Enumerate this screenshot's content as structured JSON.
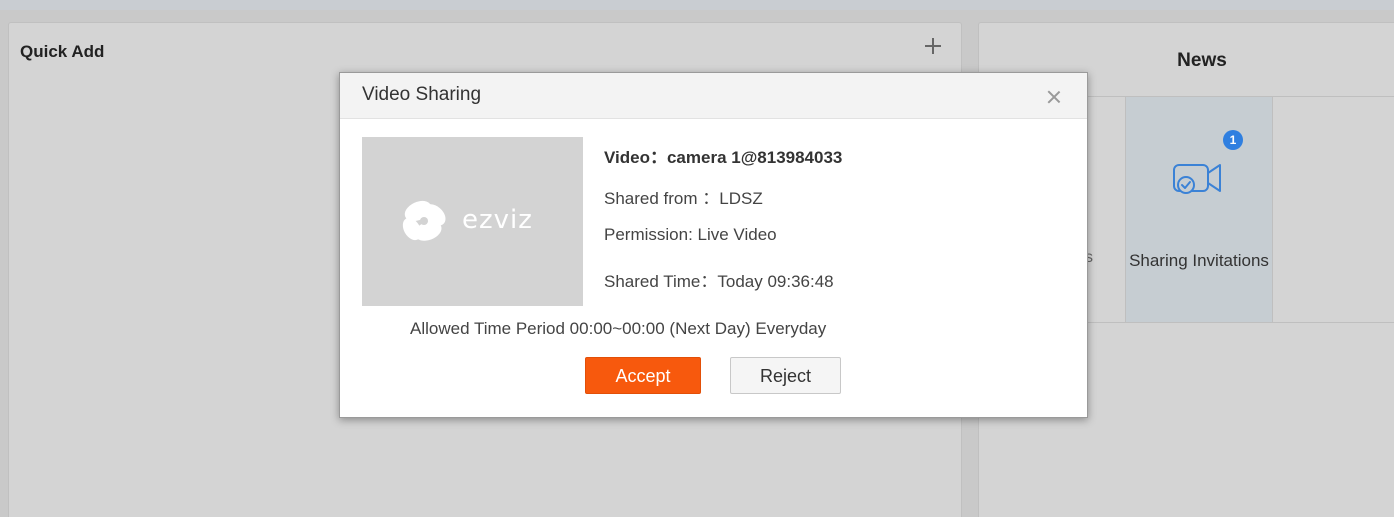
{
  "left_panel": {
    "title": "Quick Add",
    "add_icon": "plus-icon"
  },
  "right_panel": {
    "title": "News",
    "partial_tile_text": "s",
    "sharing_tile": {
      "label": "Sharing Invitations",
      "badge": "1",
      "icon": "video-share-icon"
    }
  },
  "dialog": {
    "title": "Video Sharing",
    "close_icon": "close-icon",
    "thumbnail_logo": "ezviz",
    "video": "Video：camera 1@813984033",
    "shared_from": "Shared from ：LDSZ",
    "permission": "Permission: Live Video",
    "shared_time": "Shared Time：Today 09:36:48",
    "allowed_period": "Allowed Time Period 00:00~00:00  (Next Day)    Everyday",
    "accept_label": "Accept",
    "reject_label": "Reject"
  },
  "colors": {
    "accent": "#f7590d",
    "badge": "#2f7fe0",
    "tile_highlight": "#c6cdd2"
  }
}
